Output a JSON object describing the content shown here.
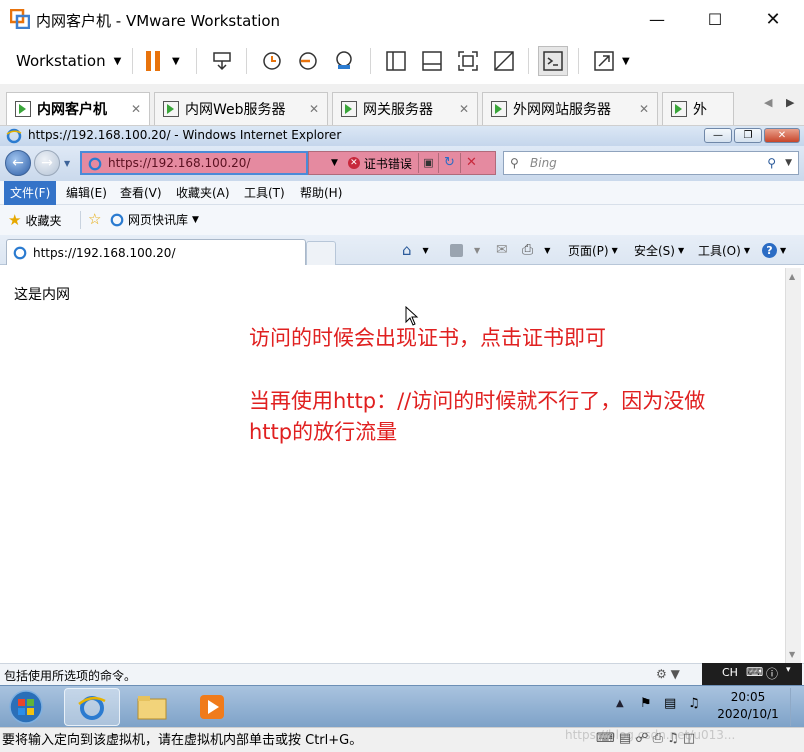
{
  "vmware": {
    "window_title": "内网客户机 - VMware Workstation",
    "toolbar_label": "Workstation",
    "tabs": [
      {
        "label": "内网客户机",
        "active": true
      },
      {
        "label": "内网Web服务器",
        "active": false
      },
      {
        "label": "网关服务器",
        "active": false
      },
      {
        "label": "外网网站服务器",
        "active": false
      },
      {
        "label": "外",
        "active": false
      }
    ],
    "status_hint": "要将输入定向到该虚拟机，请在虚拟机内部单击或按 Ctrl+G。",
    "watermark": "https://blog.csdn.net/u013..."
  },
  "ie": {
    "window_title": "https://192.168.100.20/ - Windows Internet Explorer",
    "address": "https://192.168.100.20/",
    "cert_error": "证书错误",
    "search_placeholder": "Bing",
    "menu": [
      "文件(F)",
      "编辑(E)",
      "查看(V)",
      "收藏夹(A)",
      "工具(T)",
      "帮助(H)"
    ],
    "favorites_label": "收藏夹",
    "web_slice_label": "网页快讯库",
    "tab_title": "https://192.168.100.20/",
    "commands": [
      "页面(P)",
      "安全(S)",
      "工具(O)"
    ],
    "status_text": "包括使用所选项的命令。",
    "lang": "CH"
  },
  "page": {
    "body_text": "这是内网",
    "note_line1": "访问的时候会出现证书，点击证书即可",
    "note_line2": "当再使用http：//访问的时候就不行了，因为没做",
    "note_line3": "http的放行流量"
  },
  "taskbar": {
    "time": "20:05",
    "date": "2020/10/1"
  },
  "colors": {
    "accent": "#3473c8",
    "cert_error_bg": "#e58aa0",
    "note_red": "#e02020",
    "pause_orange": "#e8730c"
  }
}
